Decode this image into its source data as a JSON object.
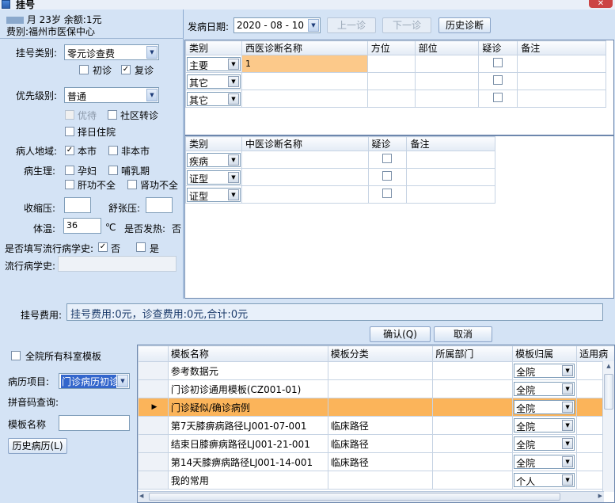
{
  "window": {
    "title": "挂号",
    "close": "✕"
  },
  "patient": {
    "name_masked": "",
    "name_suffix": "月",
    "age": "23岁",
    "balance": "余额:1元",
    "fee_type": "费别:福州市医保中心"
  },
  "left": {
    "reg_type_label": "挂号类别:",
    "reg_type_value": "零元诊查费",
    "first_visit": "初诊",
    "return_visit": "复诊",
    "priority_label": "优先级别:",
    "priority_value": "普通",
    "preferential": "优待",
    "community_transfer": "社区转诊",
    "select_day_admission": "择日住院",
    "region_label": "病人地域:",
    "local": "本市",
    "nonlocal": "非本市",
    "physio_label": "病生理:",
    "pregnant": "孕妇",
    "lactation": "哺乳期",
    "liver": "肝功不全",
    "kidney": "肾功不全",
    "systolic_label": "收缩压:",
    "diastolic_label": "舒张压:",
    "temp_label": "体温:",
    "temp_value": "36",
    "temp_unit": "℃",
    "fever_label": "是否发热:",
    "fever_value": "否",
    "epi_fill_label": "是否填写流行病学史:",
    "epi_no": "否",
    "epi_yes": "是",
    "epi_history_label": "流行病学史:"
  },
  "topbar": {
    "date_label": "发病日期:",
    "date_value": "2020 - 08 - 10",
    "prev": "上一诊",
    "next": "下一诊",
    "history": "历史诊断"
  },
  "western": {
    "headers": [
      "类别",
      "西医诊断名称",
      "方位",
      "部位",
      "疑诊",
      "备注"
    ],
    "rows": [
      {
        "type": "主要",
        "name": "1"
      },
      {
        "type": "其它",
        "name": ""
      },
      {
        "type": "其它",
        "name": ""
      }
    ]
  },
  "chinese": {
    "headers": [
      "类别",
      "中医诊断名称",
      "疑诊",
      "备注"
    ],
    "rows": [
      {
        "type": "疾病"
      },
      {
        "type": "证型"
      },
      {
        "type": "证型"
      }
    ]
  },
  "fee": {
    "label": "挂号费用:",
    "value": "挂号费用:0元，诊查费用:0元,合计:0元",
    "confirm": "确认(Q)",
    "cancel": "取消"
  },
  "bottom_left": {
    "all_dept": "全院所有科室模板",
    "record_label": "病历项目:",
    "record_value": "门诊病历初诊",
    "pinyin_label": "拼音码查询:",
    "tpl_name_label": "模板名称",
    "history_btn": "历史病历(L)"
  },
  "templates": {
    "headers": [
      "模板名称",
      "模板分类",
      "所属部门",
      "模板归属",
      "适用病"
    ],
    "rows": [
      {
        "name": "参考数据元",
        "cat": "",
        "dept": "",
        "owner": "全院"
      },
      {
        "name": "门诊初诊通用模板(CZ001-01)",
        "cat": "",
        "dept": "",
        "owner": "全院"
      },
      {
        "name": "门诊疑似/确诊病例",
        "cat": "",
        "dept": "",
        "owner": "全院"
      },
      {
        "name": "第7天膝痹病路径LJ001-07-001",
        "cat": "临床路径",
        "dept": "",
        "owner": "全院"
      },
      {
        "name": "结束日膝痹病路径LJ001-21-001",
        "cat": "临床路径",
        "dept": "",
        "owner": "全院"
      },
      {
        "name": "第14天膝痹病路径LJ001-14-001",
        "cat": "临床路径",
        "dept": "",
        "owner": "全院"
      },
      {
        "name": "我的常用",
        "cat": "",
        "dept": "",
        "owner": "个人"
      }
    ]
  }
}
